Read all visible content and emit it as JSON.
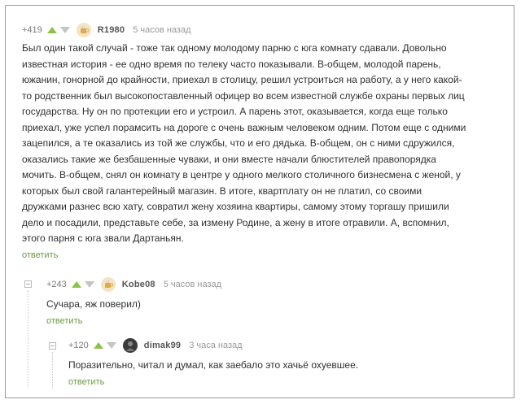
{
  "comments": [
    {
      "rating": "+419",
      "author": "R1980",
      "time": "5 часов назад",
      "avatar": "cup-icon",
      "text": "Был один такой случай - тоже так одному молодому парню с юга комнату сдавали. Довольно\nизвестная история - ее одно время по телеку часто показывали. В-общем, молодой парень,\nюжанин, гонорной до крайности, приехал в столицу, решил устроиться на работу, а у него какой-\nто родственник был высокопоставленный офицер во всем известной службе охраны первых лиц\nгосударства. Ну он по протекции его и устроил. А парень этот, оказывается, когда еще только\nприехал, уже успел порамсить на дороге с очень важным человеком одним. Потом еще с одними\nзацепился, а те оказались из той же службы, что и его дядька. В-общем, он с ними сдружился,\nоказались такие же безбашенные чуваки, и они вместе начали блюстителей правопорядка\nмочить. В-общем, снял он комнату в центре у одного мелкого столичного бизнесмена с женой, у\nкоторых был свой галантерейный магазин. В итоге, квартплату он не платил, со своими\nдружками разнес всю хату, совратил жену хозяина квартиры, самому этому торгашу пришили\nдело и посадили, представьте себе, за измену Родине, а жену в итоге отравили. А, вспомнил,\nэтого парня с юга звали Дартаньян.",
      "reply_label": "ответить"
    },
    {
      "rating": "+243",
      "author": "Kobe08",
      "time": "5 часов назад",
      "avatar": "cup-icon",
      "text": "Сучара, яж поверил)",
      "reply_label": "ответить"
    },
    {
      "rating": "+120",
      "author": "dimak99",
      "time": "3 часа назад",
      "avatar": "user-photo-icon",
      "text": "Поразительно, читал и думал, как заебало это хачьё охуевшее.",
      "reply_label": "ответить"
    }
  ]
}
